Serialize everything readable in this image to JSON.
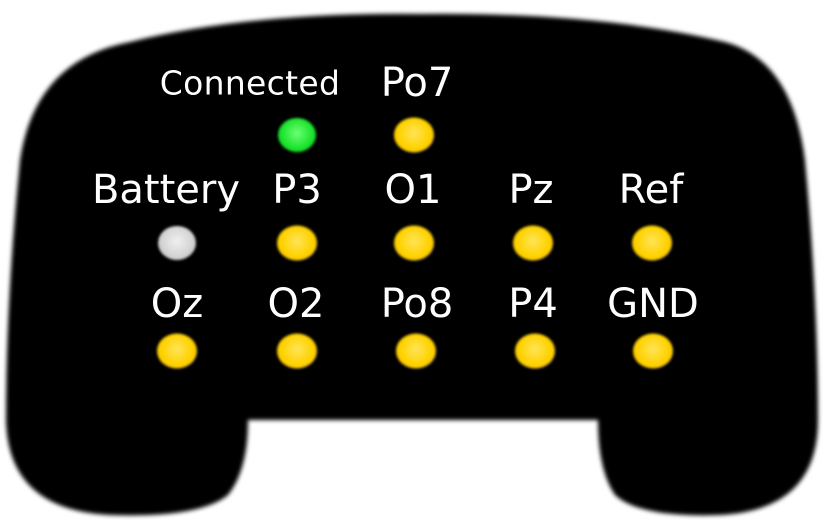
{
  "status": {
    "connected": {
      "label": "Connected",
      "color": "#18e22a"
    },
    "battery": {
      "label": "Battery",
      "color": "#d2d2d2"
    }
  },
  "electrode_color": "#ffd200",
  "device_color": "#000000",
  "electrodes": {
    "po7": "Po7",
    "p3": "P3",
    "o1": "O1",
    "pz": "Pz",
    "ref": "Ref",
    "oz": "Oz",
    "o2": "O2",
    "po8": "Po8",
    "p4": "P4",
    "gnd": "GND"
  }
}
